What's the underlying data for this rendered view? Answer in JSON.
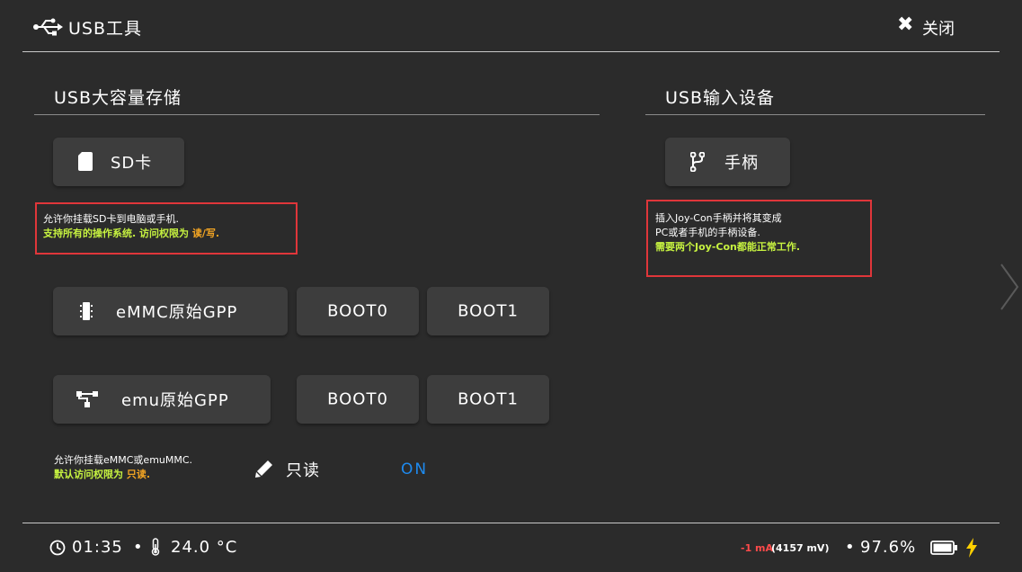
{
  "header": {
    "title": "USB工具",
    "close_label": "关闭",
    "icons": {
      "app": "usb-icon",
      "close": "close-x-icon"
    }
  },
  "mass_storage": {
    "title": "USB大容量存储",
    "sd_button": {
      "label": "SD卡",
      "icon": "sd-card-icon"
    },
    "sd_desc": {
      "line1": "允许你挂载SD卡到电脑或手机.",
      "line2_prefix": "支持所有的操作系统. 访问权限为 ",
      "line2_value": "读/写."
    },
    "emmc_button": {
      "label": "eMMC原始GPP",
      "icon": "chip-icon"
    },
    "emmc_boot0": "BOOT0",
    "emmc_boot1": "BOOT1",
    "emu_button": {
      "label": "emu原始GPP",
      "icon": "network-icon"
    },
    "emu_boot0": "BOOT0",
    "emu_boot1": "BOOT1",
    "mount_desc": {
      "line1": "允许你挂载eMMC或emuMMC.",
      "line2_prefix": "默认访问权限为 ",
      "line2_value": "只读."
    },
    "readonly": {
      "label": "只读",
      "icon": "pencil-icon",
      "value": "ON"
    }
  },
  "input_devices": {
    "title": "USB输入设备",
    "gamepad_button": {
      "label": "手柄",
      "icon": "fork-icon"
    },
    "desc": {
      "line1": "插入Joy-Con手柄并将其变成",
      "line2": "PC或者手机的手柄设备.",
      "line3": "需要两个Joy-Con都能正常工作."
    }
  },
  "footer": {
    "time": "01:35",
    "separator": "•",
    "temperature": "24.0 °C",
    "current": "-1 mA",
    "voltage": "(4157 mV)",
    "battery": "97.6%",
    "icons": [
      "clock-icon",
      "thermometer-icon",
      "battery-icon",
      "charging-bolt-icon"
    ]
  },
  "colors": {
    "background": "#2b2b2b",
    "button": "#3d3d3d",
    "highlight_box": "#e0363a",
    "note_yellow": "#c6f240",
    "note_orange": "#f5a623",
    "toggle_on": "#1e8bf0",
    "charging": "#ffd000",
    "current_red": "#ff4a4a"
  }
}
